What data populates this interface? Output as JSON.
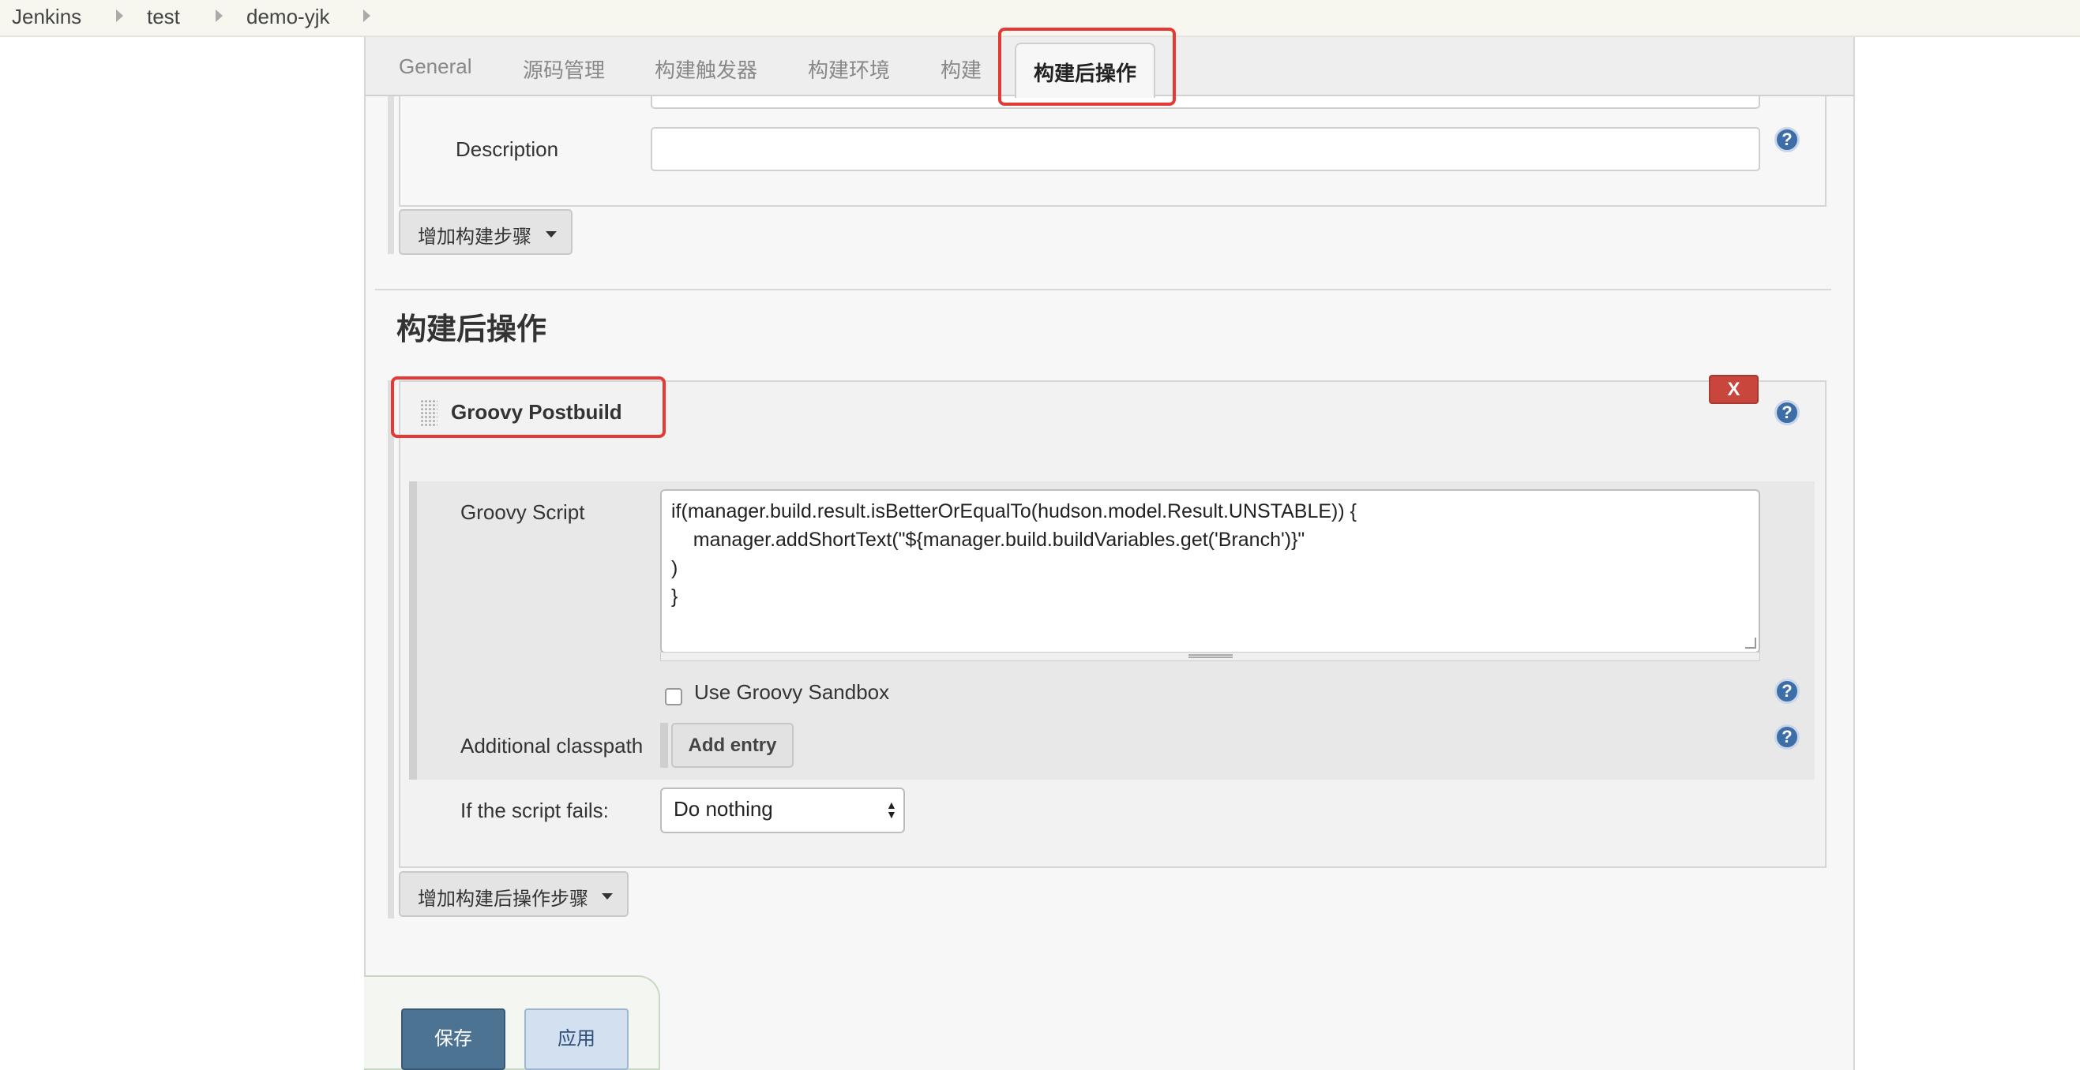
{
  "breadcrumb": {
    "items": [
      "Jenkins",
      "test",
      "demo-yjk"
    ]
  },
  "tabs": [
    {
      "label": "General",
      "active": false
    },
    {
      "label": "源码管理",
      "active": false
    },
    {
      "label": "构建触发器",
      "active": false
    },
    {
      "label": "构建环境",
      "active": false
    },
    {
      "label": "构建",
      "active": false
    },
    {
      "label": "构建后操作",
      "active": true
    }
  ],
  "build_section": {
    "description_label": "Description",
    "description_value": "",
    "add_step_label": "增加构建步骤"
  },
  "post_build": {
    "section_title": "构建后操作",
    "plugin_title": "Groovy Postbuild",
    "delete_label": "X",
    "groovy_script_label": "Groovy Script",
    "groovy_script_value": "if(manager.build.result.isBetterOrEqualTo(hudson.model.Result.UNSTABLE)) {\n    manager.addShortText(\"${manager.build.buildVariables.get('Branch')}\"\n)\n}",
    "sandbox_label": "Use Groovy Sandbox",
    "sandbox_checked": false,
    "classpath_label": "Additional classpath",
    "add_entry_label": "Add entry",
    "script_fails_label": "If the script fails:",
    "script_fails_value": "Do nothing",
    "add_post_step_label": "增加构建后操作步骤"
  },
  "help_icon_glyph": "?",
  "footer": {
    "save_label": "保存",
    "apply_label": "应用"
  },
  "colors": {
    "highlight": "#e53935",
    "delete_button": "#c9463d",
    "save_button": "#4c7391",
    "help_icon": "#3e6ea8"
  }
}
